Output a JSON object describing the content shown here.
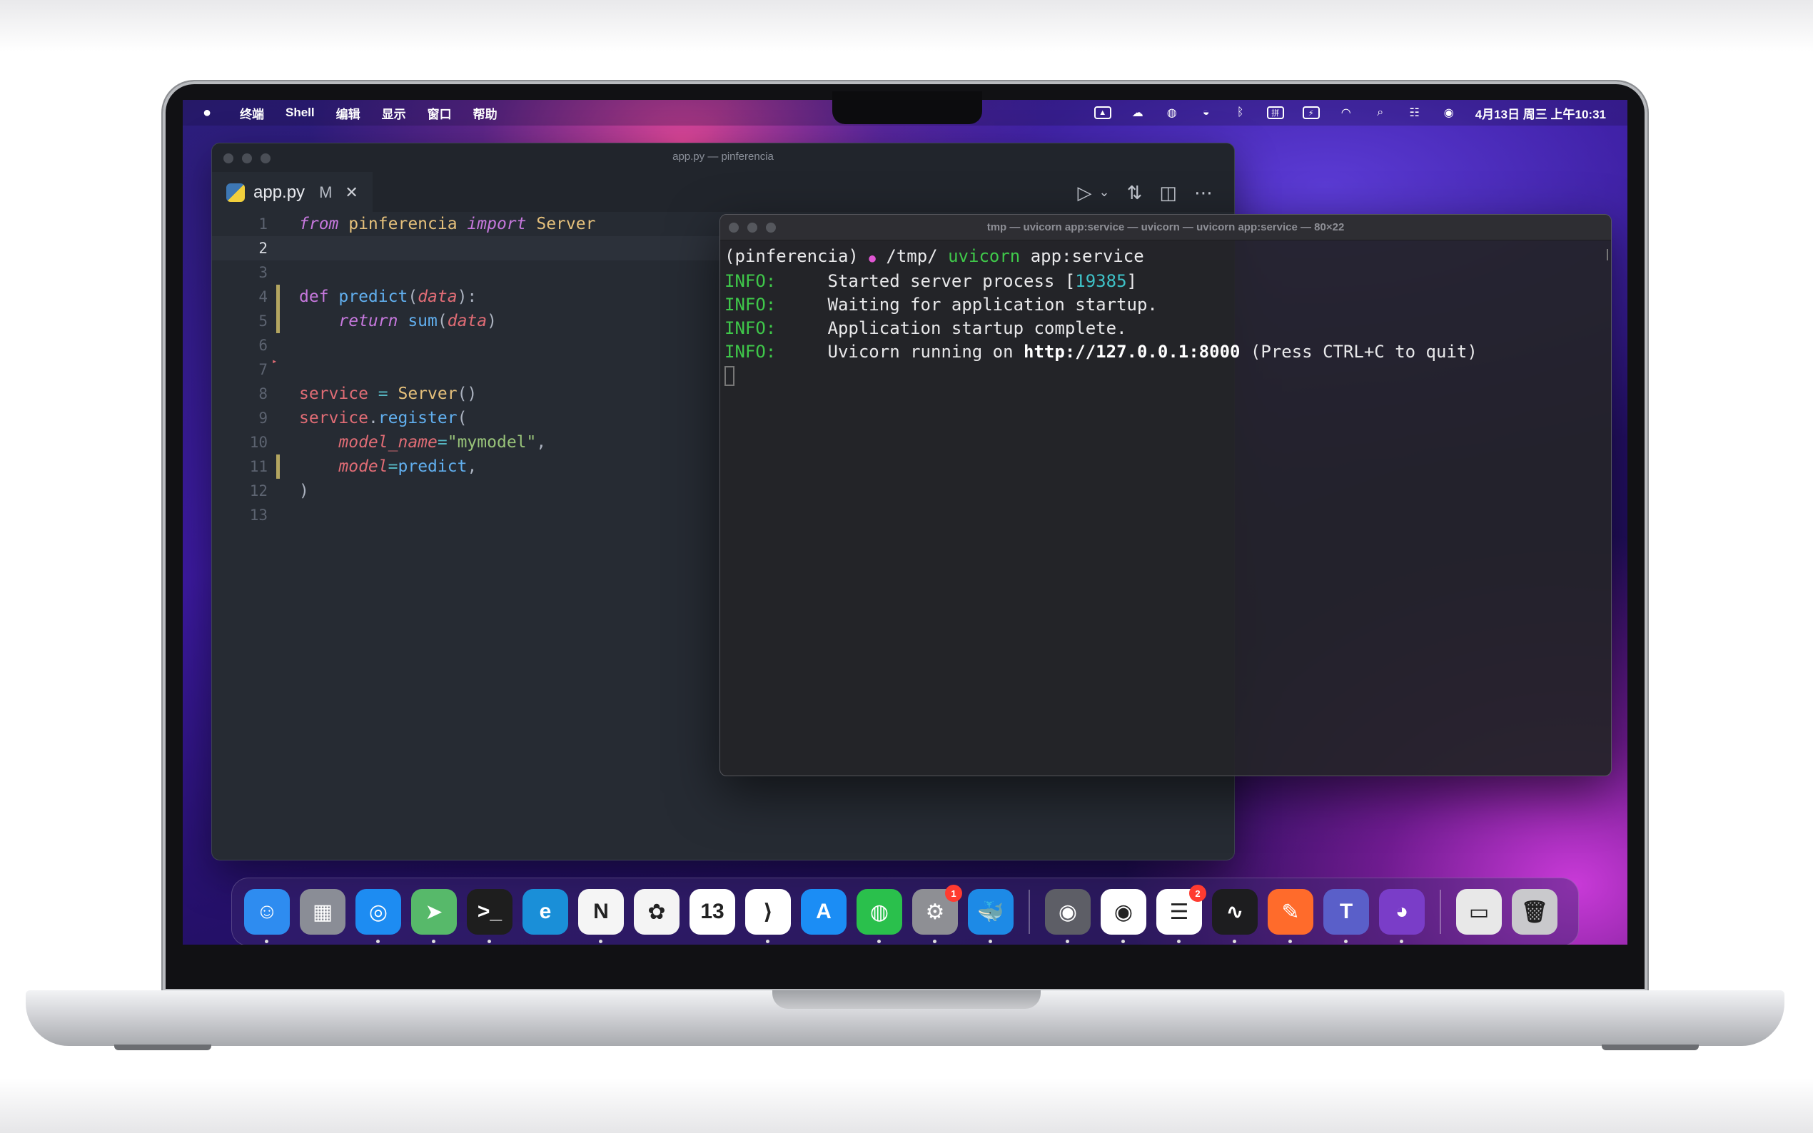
{
  "menubar": {
    "apple": "",
    "items": [
      "终端",
      "Shell",
      "编辑",
      "显示",
      "窗口",
      "帮助"
    ],
    "status_icons": [
      "image-icon",
      "cloud-icon",
      "wechat-icon",
      "bowl-icon",
      "bluetooth-icon",
      "input-icon",
      "battery-icon",
      "wifi-icon",
      "search-icon",
      "control-center-icon",
      "siri-icon"
    ],
    "clock": "4月13日 周三 上午10:31"
  },
  "editor": {
    "window_title": "app.py — pinferencia",
    "tab": {
      "filename": "app.py",
      "modified": "M",
      "close": "✕"
    },
    "actions": [
      "▷",
      "⌄",
      "⇅",
      "◫",
      "⋯"
    ],
    "lines": [
      {
        "n": "1"
      },
      {
        "n": "2"
      },
      {
        "n": "3"
      },
      {
        "n": "4"
      },
      {
        "n": "5"
      },
      {
        "n": "6"
      },
      {
        "n": "7"
      },
      {
        "n": "8"
      },
      {
        "n": "9"
      },
      {
        "n": "10"
      },
      {
        "n": "11"
      },
      {
        "n": "12"
      },
      {
        "n": "13"
      }
    ],
    "code": {
      "l1_from": "from",
      "l1_mod": " pinferencia ",
      "l1_import": "import",
      "l1_cls": " Server",
      "l4_def": "def",
      "l4_fn": " predict",
      "l4_open": "(",
      "l4_param": "data",
      "l4_close": "):",
      "l5_indent": "    ",
      "l5_return": "return",
      "l5_sum": " sum",
      "l5_open": "(",
      "l5_arg": "data",
      "l5_close": ")",
      "l8_var": "service",
      "l8_eq": " = ",
      "l8_cls": "Server",
      "l8_paren": "()",
      "l9_var": "service",
      "l9_dot": ".",
      "l9_fn": "register",
      "l9_open": "(",
      "l10_indent": "    ",
      "l10_kw": "model_name",
      "l10_eq": "=",
      "l10_str": "\"mymodel\"",
      "l10_comma": ",",
      "l11_indent": "    ",
      "l11_kw": "model",
      "l11_eq": "=",
      "l11_fn": "predict",
      "l11_comma": ",",
      "l12": ")"
    }
  },
  "terminal": {
    "title": "tmp — uvicorn app:service — uvicorn — uvicorn app:service — 80×22",
    "prompt_env": "(pinferencia)",
    "prompt_symbol": "●",
    "prompt_path": " /tmp/ ",
    "cmd": "uvicorn",
    "cmd_arg": " app:service",
    "info": "INFO:",
    "l1_pre": "     Started server process [",
    "pid": "19385",
    "l1_post": "]",
    "l2": "     Waiting for application startup.",
    "l3": "     Application startup complete.",
    "l4_pre": "     Uvicorn running on ",
    "url": "http://127.0.0.1:8000",
    "l4_post": " (Press CTRL+C to quit)"
  },
  "dock": {
    "apps": [
      {
        "name": "finder",
        "glyph": "☺",
        "color": "#2e8cf0"
      },
      {
        "name": "launchpad",
        "glyph": "▦",
        "color": "#8a8d96"
      },
      {
        "name": "safari",
        "glyph": "◎",
        "color": "#1d8cf2"
      },
      {
        "name": "maps",
        "glyph": "➤",
        "color": "#57b96a"
      },
      {
        "name": "terminal",
        "glyph": ">_",
        "color": "#1e1e1e"
      },
      {
        "name": "edge",
        "glyph": "e",
        "color": "#1a8fd8"
      },
      {
        "name": "notion",
        "glyph": "N",
        "color": "#f5f5f5"
      },
      {
        "name": "photos",
        "glyph": "✿",
        "color": "#f4f4f4"
      },
      {
        "name": "calendar",
        "glyph": "13",
        "color": "#ffffff"
      },
      {
        "name": "vscode",
        "glyph": "⟩",
        "color": "#ffffff"
      },
      {
        "name": "app-store",
        "glyph": "A",
        "color": "#1b8df5"
      },
      {
        "name": "wechat",
        "glyph": "◍",
        "color": "#2ac04c"
      },
      {
        "name": "system-preferences",
        "glyph": "⚙",
        "color": "#8e8f94",
        "badge": "1"
      },
      {
        "name": "docker",
        "glyph": "🐳",
        "color": "#1d8ae6"
      },
      {
        "name": "xcode-instruments",
        "glyph": "◉",
        "color": "#5d5e66"
      },
      {
        "name": "chrome",
        "glyph": "◉",
        "color": "#ffffff"
      },
      {
        "name": "reminders",
        "glyph": "☰",
        "color": "#ffffff",
        "badge": "2"
      },
      {
        "name": "activity-monitor",
        "glyph": "∿",
        "color": "#1d1d1f"
      },
      {
        "name": "pencil-app",
        "glyph": "✎",
        "color": "#ff6b2b"
      },
      {
        "name": "teams",
        "glyph": "T",
        "color": "#5a5fc9"
      },
      {
        "name": "github-desktop",
        "glyph": "◕",
        "color": "#7a3dc8"
      },
      {
        "name": "screen",
        "glyph": "▭",
        "color": "#e8e8e8"
      },
      {
        "name": "trash",
        "glyph": "🗑",
        "color": "#c9c9cc"
      }
    ]
  }
}
